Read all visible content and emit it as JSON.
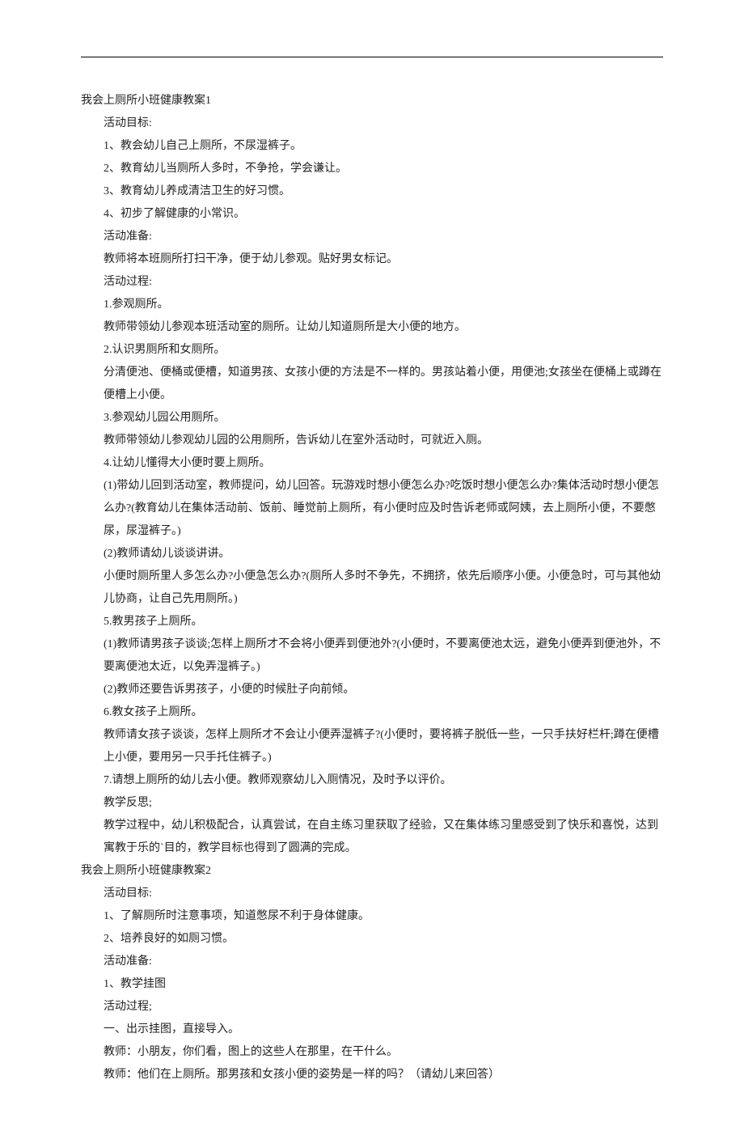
{
  "doc": {
    "sections": [
      {
        "title": "我会上厕所小班健康教案1",
        "lines": [
          "活动目标:",
          "1、教会幼儿自己上厕所，不尿湿裤子。",
          "2、教育幼儿当厕所人多时，不争抢，学会谦让。",
          "3、教育幼儿养成清洁卫生的好习惯。",
          "4、初步了解健康的小常识。",
          "活动准备:",
          "教师将本班厕所打扫干净，便于幼儿参观。贴好男女标记。",
          "活动过程:",
          "1.参观厕所。",
          "教师带领幼儿参观本班活动室的厕所。让幼儿知道厕所是大小便的地方。",
          "2.认识男厕所和女厕所。",
          "分清便池、便桶或便槽，知道男孩、女孩小便的方法是不一样的。男孩站着小便，用便池;女孩坐在便桶上或蹲在便槽上小便。",
          "3.参观幼儿园公用厕所。",
          "教师带领幼儿参观幼儿园的公用厕所，告诉幼儿在室外活动时，可就近入厕。",
          "4.让幼儿懂得大小便时要上厕所。",
          "(1)带幼儿回到活动室，教师提问，幼儿回答。玩游戏时想小便怎么办?吃饭时想小便怎么办?集体活动时想小便怎么办?(教育幼儿在集体活动前、饭前、睡觉前上厕所，有小便时应及时告诉老师或阿姨，去上厕所小便，不要憋尿，尿湿裤子。)",
          "(2)教师请幼儿谈谈讲讲。",
          "小便时厕所里人多怎么办?小便急怎么办?(厕所人多时不争先，不拥挤，依先后顺序小便。小便急时，可与其他幼儿协商，让自己先用厕所。)",
          "5.教男孩子上厕所。",
          "(1)教师请男孩子谈谈;怎样上厕所才不会将小便弄到便池外?(小便时，不要离便池太远，避免小便弄到便池外，不要离便池太近，以免弄湿裤子。)",
          "(2)教师还要告诉男孩子，小便的时候肚子向前倾。",
          "6.教女孩子上厕所。",
          "教师请女孩子谈谈，怎样上厕所才不会让小便弄湿裤子?(小便时，要将裤子脱低一些，一只手扶好栏杆;蹲在便槽上小便，要用另一只手托住裤子。)",
          "7.请想上厕所的幼儿去小便。教师观察幼儿入厕情况，及时予以评价。",
          "教学反思;",
          "教学过程中，幼儿积极配合，认真尝试，在自主练习里获取了经验，又在集体练习里感受到了快乐和喜悦，达到寓教于乐的`目的，教学目标也得到了圆满的完成。"
        ]
      },
      {
        "title": "我会上厕所小班健康教案2",
        "lines": [
          "活动目标:",
          "1、了解厕所时注意事项，知道憋尿不利于身体健康。",
          "2、培养良好的如厕习惯。",
          "活动准备:",
          "1、教学挂图",
          "活动过程;",
          "一、出示挂图，直接导入。",
          "教师：小朋友，你们看，图上的这些人在那里，在干什么。",
          "教师：他们在上厕所。那男孩和女孩小便的姿势是一样的吗？（请幼儿来回答）"
        ]
      }
    ]
  }
}
